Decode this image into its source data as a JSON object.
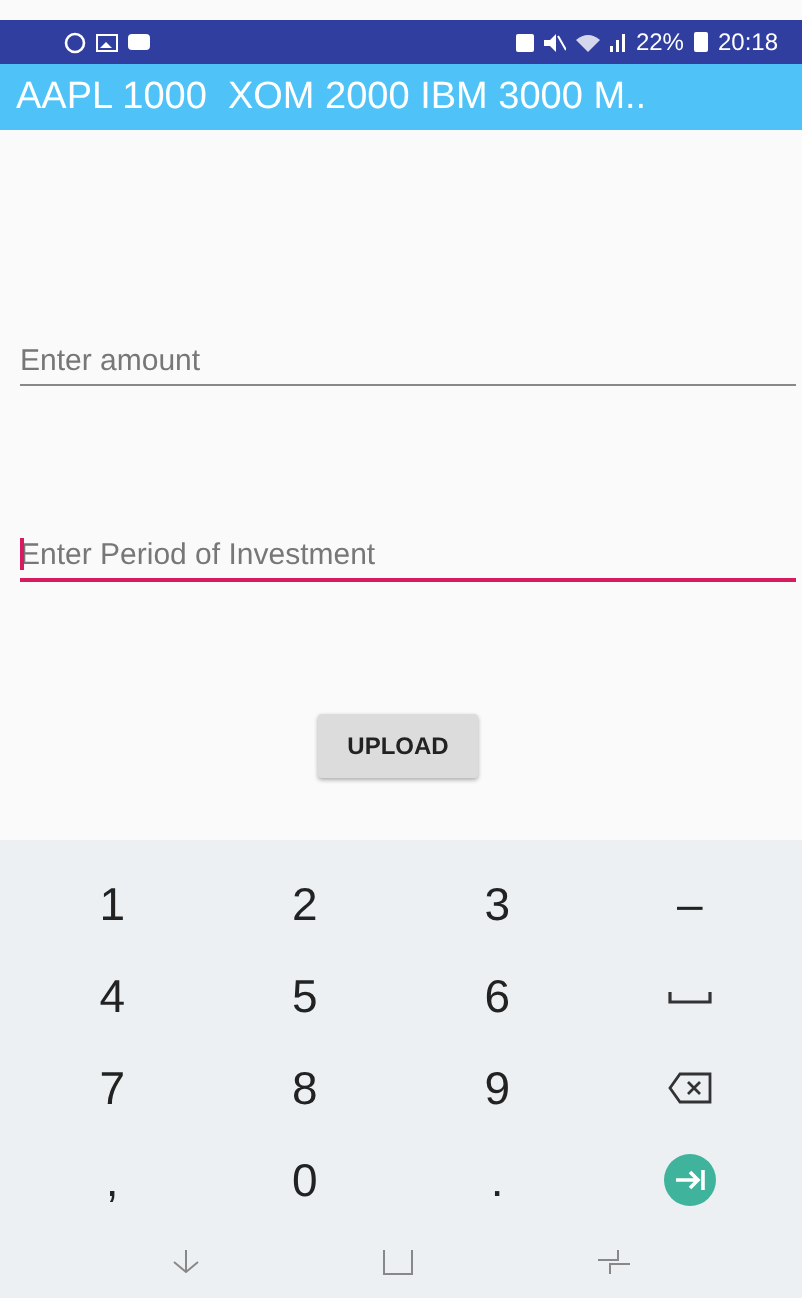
{
  "status_bar": {
    "battery_text": "22%",
    "time": "20:18"
  },
  "banner": {
    "text": "AAPL 1000  XOM 2000 IBM 3000 M.."
  },
  "fields": [
    {
      "placeholder": "Enter amount",
      "focused": false
    },
    {
      "placeholder": "Enter Period of Investment",
      "focused": true
    }
  ],
  "upload_button": {
    "label": "UPLOAD"
  },
  "keyboard": {
    "keys": [
      {
        "kind": "text",
        "label": "1"
      },
      {
        "kind": "text",
        "label": "2"
      },
      {
        "kind": "text",
        "label": "3"
      },
      {
        "kind": "text",
        "label": "–"
      },
      {
        "kind": "text",
        "label": "4"
      },
      {
        "kind": "text",
        "label": "5"
      },
      {
        "kind": "text",
        "label": "6"
      },
      {
        "kind": "space"
      },
      {
        "kind": "text",
        "label": "7"
      },
      {
        "kind": "text",
        "label": "8"
      },
      {
        "kind": "text",
        "label": "9"
      },
      {
        "kind": "backspace"
      },
      {
        "kind": "text",
        "label": ","
      },
      {
        "kind": "text",
        "label": "0"
      },
      {
        "kind": "text",
        "label": "."
      },
      {
        "kind": "next"
      }
    ]
  }
}
